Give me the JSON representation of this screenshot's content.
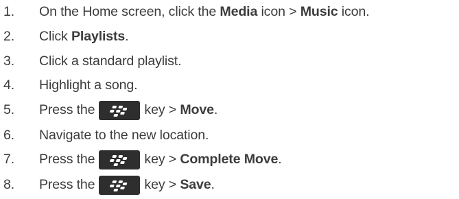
{
  "steps": [
    {
      "num": "1.",
      "segments": [
        {
          "t": "text",
          "v": "On the Home screen, click the "
        },
        {
          "t": "bold",
          "v": "Media"
        },
        {
          "t": "text",
          "v": " icon > "
        },
        {
          "t": "bold",
          "v": "Music"
        },
        {
          "t": "text",
          "v": " icon."
        }
      ]
    },
    {
      "num": "2.",
      "segments": [
        {
          "t": "text",
          "v": "Click "
        },
        {
          "t": "bold",
          "v": "Playlists"
        },
        {
          "t": "text",
          "v": "."
        }
      ]
    },
    {
      "num": "3.",
      "segments": [
        {
          "t": "text",
          "v": "Click a standard playlist."
        }
      ]
    },
    {
      "num": "4.",
      "segments": [
        {
          "t": "text",
          "v": "Highlight a song."
        }
      ]
    },
    {
      "num": "5.",
      "segments": [
        {
          "t": "text",
          "v": "Press the"
        },
        {
          "t": "key",
          "icon": "blackberry-menu-key-icon"
        },
        {
          "t": "text",
          "v": "key > "
        },
        {
          "t": "bold",
          "v": "Move"
        },
        {
          "t": "text",
          "v": "."
        }
      ]
    },
    {
      "num": "6.",
      "segments": [
        {
          "t": "text",
          "v": "Navigate to the new location."
        }
      ]
    },
    {
      "num": "7.",
      "segments": [
        {
          "t": "text",
          "v": "Press the"
        },
        {
          "t": "key",
          "icon": "blackberry-menu-key-icon"
        },
        {
          "t": "text",
          "v": "key > "
        },
        {
          "t": "bold",
          "v": "Complete Move"
        },
        {
          "t": "text",
          "v": "."
        }
      ]
    },
    {
      "num": "8.",
      "segments": [
        {
          "t": "text",
          "v": "Press the"
        },
        {
          "t": "key",
          "icon": "blackberry-menu-key-icon"
        },
        {
          "t": "text",
          "v": "key > "
        },
        {
          "t": "bold",
          "v": "Save"
        },
        {
          "t": "text",
          "v": "."
        }
      ]
    }
  ]
}
